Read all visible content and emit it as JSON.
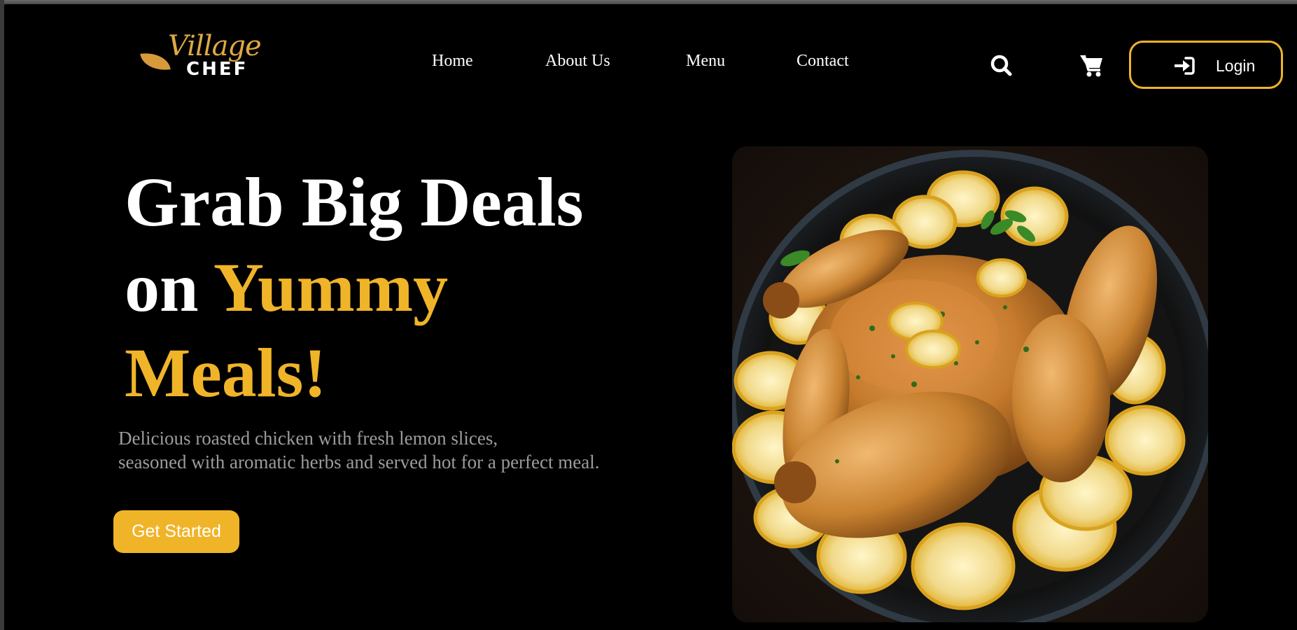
{
  "brand": {
    "logo_script": "Village",
    "logo_word": "CHEF"
  },
  "nav": {
    "items": [
      {
        "label": "Home"
      },
      {
        "label": "About Us"
      },
      {
        "label": "Menu"
      },
      {
        "label": "Contact"
      }
    ],
    "login_label": "Login",
    "icons": [
      "search-icon",
      "cart-icon",
      "login-icon"
    ]
  },
  "hero": {
    "title_line1": "Grab Big Deals",
    "title_line2_plain": "on ",
    "title_line2_accent": "Yummy",
    "title_line3_accent": "Meals!",
    "description_line1": "Delicious roasted chicken with fresh lemon slices,",
    "description_line2": "seasoned with aromatic herbs and served hot for a perfect meal.",
    "cta_label": "Get Started"
  },
  "colors": {
    "accent": "#f0b429",
    "background": "#000000",
    "text": "#ffffff",
    "muted_text": "#9c9c9c"
  }
}
